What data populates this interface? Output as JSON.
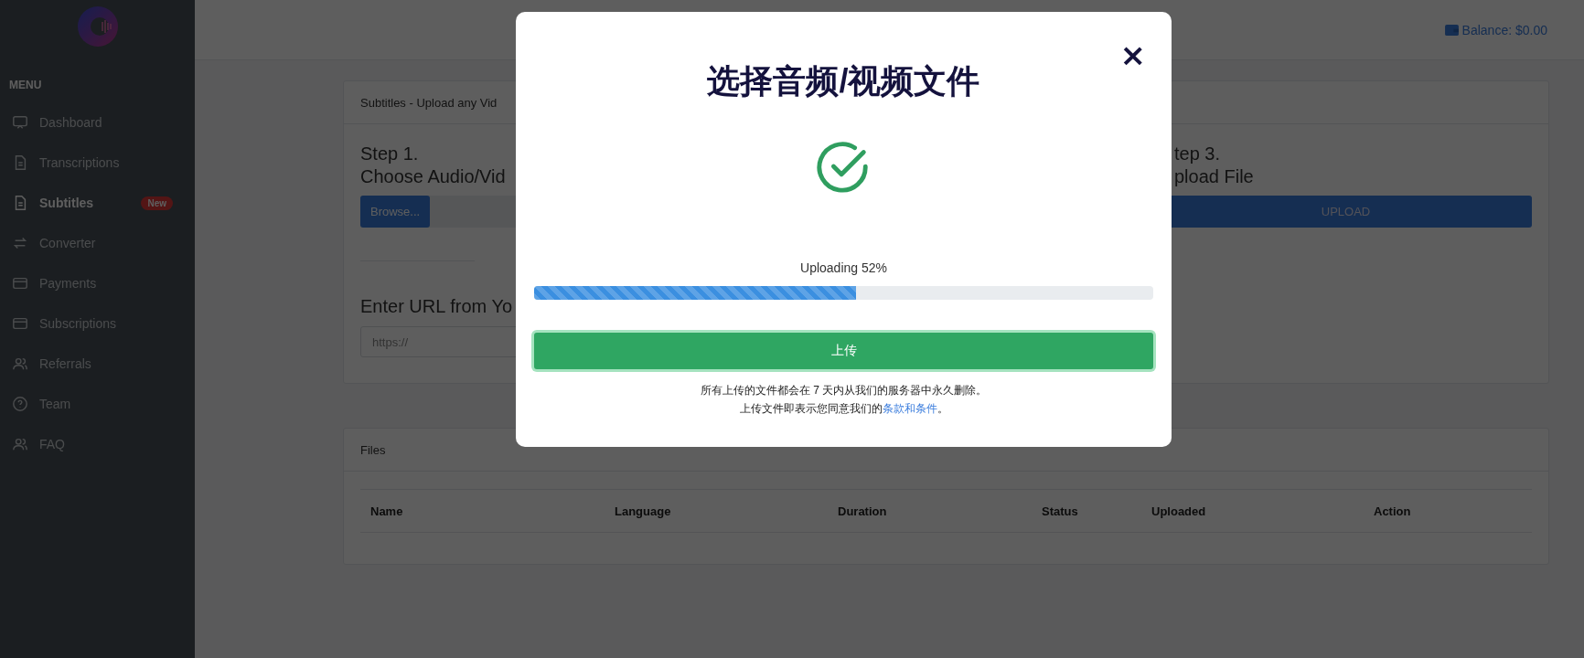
{
  "header": {
    "balance": "Balance: $0.00"
  },
  "sidebar": {
    "menu_label": "MENU",
    "items": [
      {
        "label": "Dashboard",
        "selected": false
      },
      {
        "label": "Transcriptions",
        "selected": false
      },
      {
        "label": "Subtitles",
        "selected": true,
        "badge": "New"
      },
      {
        "label": "Converter",
        "selected": false
      },
      {
        "label": "Payments",
        "selected": false
      },
      {
        "label": "Subscriptions",
        "selected": false
      },
      {
        "label": "Referrals",
        "selected": false
      },
      {
        "label": "Team",
        "selected": false
      },
      {
        "label": "FAQ",
        "selected": false
      }
    ]
  },
  "upload_card": {
    "title": "Subtitles - Upload any Vid",
    "step_1": {
      "title": "Step 1.",
      "subtitle": "Choose Audio/Vid",
      "button": "Browse..."
    },
    "step_3": {
      "title": "tep 3.",
      "subtitle": "pload File",
      "button": "UPLOAD"
    },
    "url_title": "Enter URL from Yo",
    "url_field": {
      "placeholder": "https://"
    }
  },
  "files_card": {
    "title": "Files",
    "columns": [
      "Name",
      "Language",
      "Duration",
      "Status",
      "Uploaded",
      "Action"
    ]
  },
  "modal": {
    "title": "选择音频/视频文件",
    "close": "×",
    "status": "Uploading 52%",
    "progress": {
      "level": 0.52
    },
    "button": "上传",
    "note_line_1": "所有上传的文件都会在 7 天内从我们的服务器中永久删除。",
    "note_line_2": "上传文件即表示您同意我们的",
    "link": "条款和条件",
    "note_end": "。"
  }
}
